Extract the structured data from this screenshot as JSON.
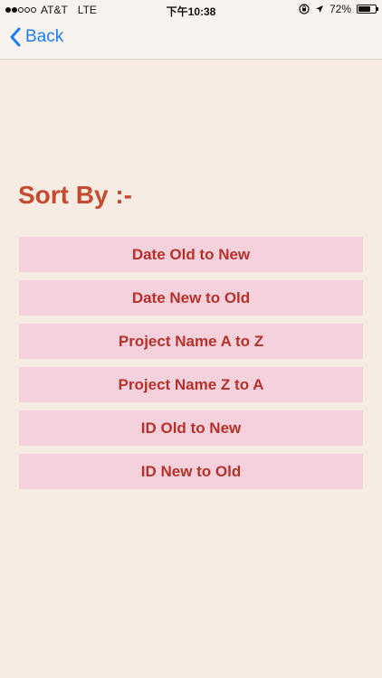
{
  "status_bar": {
    "carrier": "AT&T",
    "network": "LTE",
    "time": "下午10:38",
    "battery": "72%",
    "battery_level": 0.72,
    "signal_bars": [
      true,
      true,
      false,
      false,
      false
    ]
  },
  "nav": {
    "back_label": "Back"
  },
  "main": {
    "title": "Sort By :-",
    "options": [
      {
        "label": "Date Old to New"
      },
      {
        "label": "Date New to Old"
      },
      {
        "label": "Project Name A to Z"
      },
      {
        "label": "Project Name Z to A"
      },
      {
        "label": "ID Old to New"
      },
      {
        "label": "ID New to Old"
      }
    ]
  },
  "colors": {
    "background": "#f6ece4",
    "accent_title": "#c54a2e",
    "button_bg": "#f4d1dc",
    "button_text": "#b5322b",
    "link_blue": "#1d7cf2"
  }
}
